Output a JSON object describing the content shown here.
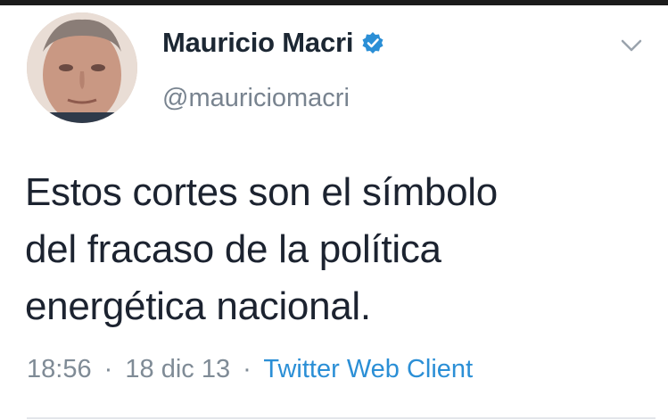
{
  "colors": {
    "name": "#1c2733",
    "handle": "#78838f",
    "body_text": "#1c2330",
    "meta": "#7f8b96",
    "client_link": "#2b8fd6",
    "verified_badge": "#2b8fd6"
  },
  "user": {
    "display_name": "Mauricio Macri",
    "handle": "@mauriciomacri",
    "verified_icon": "verified-badge-icon",
    "menu_icon": "chevron-down-icon"
  },
  "tweet": {
    "lines": [
      "Estos cortes son el símbolo",
      "del fracaso de la política",
      "energética nacional."
    ]
  },
  "meta": {
    "time": "18:56",
    "separator": "·",
    "date": "18 dic 13",
    "client": "Twitter Web Client"
  }
}
